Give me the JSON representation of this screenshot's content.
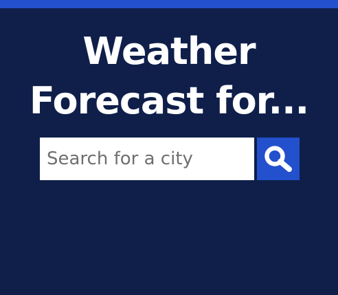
{
  "header": {
    "title": "Weather Forecast for..."
  },
  "search": {
    "placeholder": "Search for a city",
    "value": "",
    "button_icon": "search-icon"
  },
  "colors": {
    "background": "#0f1f4a",
    "accent": "#2350cc",
    "title_text": "#ffffff",
    "input_background": "#ffffff",
    "placeholder_text": "#6f6f6f"
  }
}
